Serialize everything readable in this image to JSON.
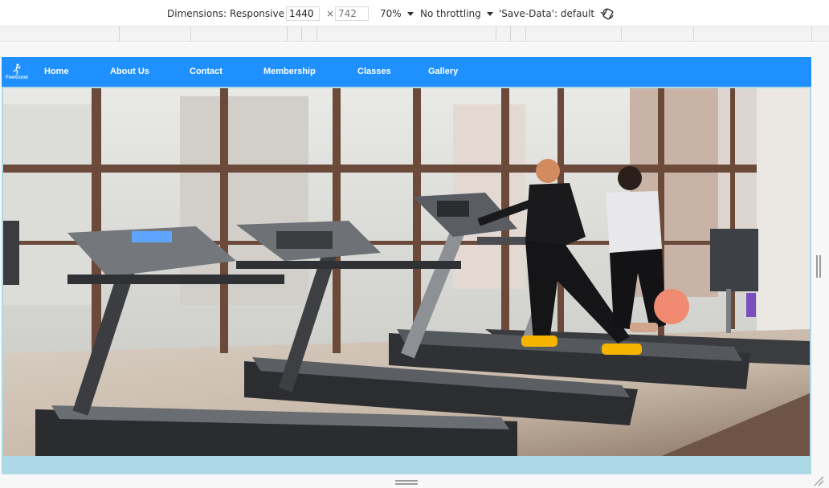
{
  "devtools": {
    "dimensions_label": "Dimensions: Responsive",
    "width_value": "1440",
    "height_placeholder": "742",
    "times": "×",
    "zoom": "70%",
    "throttling": "No throttling",
    "save_data": "'Save-Data': default"
  },
  "site": {
    "logo_text": "FeelGood",
    "nav": [
      "Home",
      "About Us",
      "Contact",
      "Membership",
      "Classes",
      "Gallery"
    ],
    "hero_alt": "Gym treadmills by large windows with two women walking"
  },
  "colors": {
    "nav_bg": "#1e90ff",
    "page_bg": "#add8e6"
  }
}
